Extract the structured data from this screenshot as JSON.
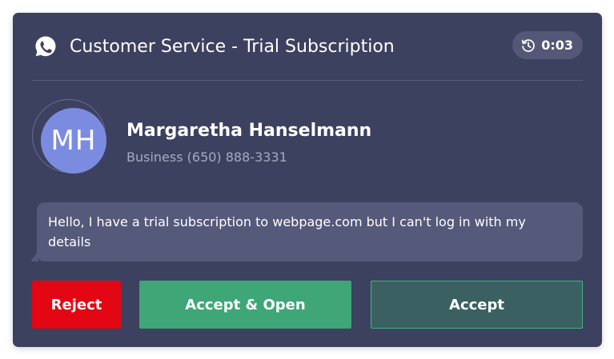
{
  "header": {
    "title": "Customer Service - Trial Subscription",
    "channel_icon": "whatsapp-icon",
    "timer": "0:03",
    "timer_icon": "history-clock-icon"
  },
  "contact": {
    "initials": "MH",
    "name": "Margaretha Hanselmann",
    "phone": "Business (650) 888-3331"
  },
  "message": {
    "text": "Hello, I have a trial subscription to webpage.com but I can't log in with my details"
  },
  "actions": {
    "reject_label": "Reject",
    "accept_open_label": "Accept & Open",
    "accept_label": "Accept"
  },
  "colors": {
    "card_background": "#3d4160",
    "avatar": "#7b8ce0",
    "message_bubble": "#55597a",
    "reject": "#e30613",
    "accept_open": "#3fa677",
    "accept": "#3a6061",
    "accept_border": "#44b382"
  }
}
